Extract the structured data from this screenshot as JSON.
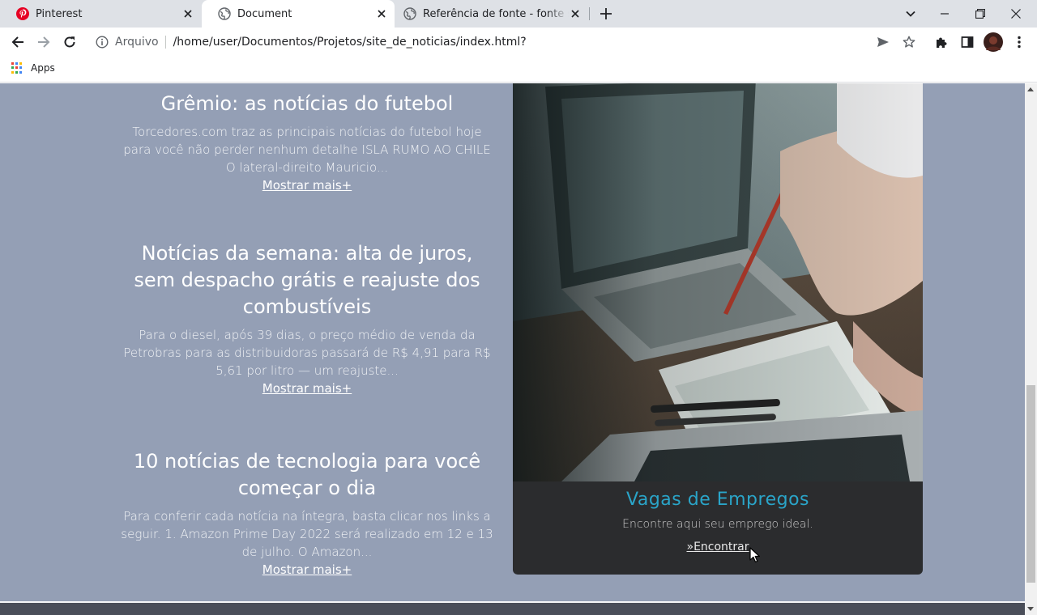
{
  "browser": {
    "tabs": [
      {
        "title": "Pinterest",
        "icon": "pinterest-icon",
        "active": false
      },
      {
        "title": "Document",
        "icon": "globe-icon",
        "active": true
      },
      {
        "title": "Referência de fonte - fonte sem f",
        "icon": "globe-icon",
        "active": false
      }
    ],
    "omnibox": {
      "security_label": "Arquivo",
      "url": "/home/user/Documentos/Projetos/site_de_noticias/index.html?"
    },
    "bookmarks": {
      "apps_label": "Apps"
    }
  },
  "page": {
    "articles": [
      {
        "title": "Grêmio: as notícias do futebol",
        "text": "Torcedores.com traz as principais notícias do futebol hoje para você não perder nenhum detalhe ISLA RUMO AO CHILE O lateral-direito Mauricio...",
        "more": "Mostrar mais+"
      },
      {
        "title": "Notícias da semana: alta de juros, sem despacho grátis e reajuste dos combustíveis",
        "text": "Para o diesel, após 39 dias, o preço médio de venda da Petrobras para as distribuidoras passará de R$ 4,91 para R$ 5,61 por litro — um reajuste...",
        "more": "Mostrar mais+"
      },
      {
        "title": "10 notícias de tecnologia para você começar o dia",
        "text": "Para conferir cada notícia na íntegra, basta clicar nos links a seguir. 1. Amazon Prime Day 2022 será realizado em 12 e 13 de julho. O Amazon...",
        "more": "Mostrar mais+"
      }
    ],
    "jobs_card": {
      "title": "Vagas de Empregos",
      "subtitle": "Encontre aqui seu emprego ideal.",
      "link_icon": "»",
      "link_label": "Encontrar"
    }
  },
  "colors": {
    "page_background": "#949fb5",
    "card_caption_bg": "#2b2c2e",
    "card_title": "#2aa5c9",
    "pinterest": "#e60023"
  }
}
